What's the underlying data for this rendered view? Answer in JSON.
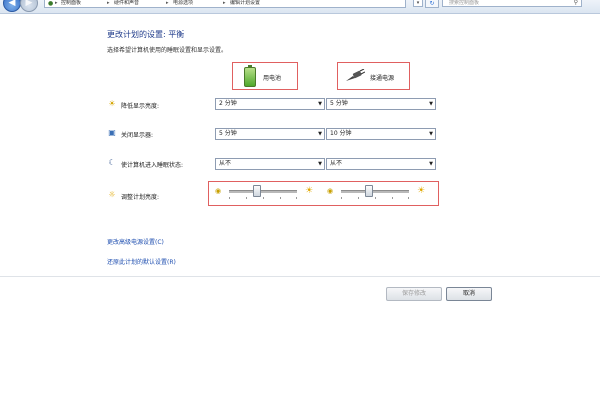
{
  "address_bar": {
    "crumbs": [
      "控制面板",
      "硬件和声音",
      "电源选项",
      "编辑计划设置"
    ],
    "search_placeholder": "搜索控制面板"
  },
  "page": {
    "title": "更改计划的设置: 平衡",
    "subtitle": "选择希望计算机使用的睡眠设置和显示设置。"
  },
  "columns": {
    "on_battery": "用电池",
    "plugged_in": "接通电源"
  },
  "settings": [
    {
      "label": "降低显示亮度:",
      "icon": "dim-display-icon",
      "battery": "2 分钟",
      "plugged": "5 分钟"
    },
    {
      "label": "关闭显示器:",
      "icon": "monitor-icon",
      "battery": "5 分钟",
      "plugged": "10 分钟"
    },
    {
      "label": "使计算机进入睡眠状态:",
      "icon": "sleep-moon-icon",
      "battery": "从不",
      "plugged": "从不"
    }
  ],
  "brightness": {
    "label": "调整计划亮度:",
    "battery_level": 0.4,
    "plugged_level": 0.4
  },
  "links": {
    "advanced": "更改高级电源设置(C)",
    "restore": "还原此计划的默认设置(R)"
  },
  "buttons": {
    "save": "保存修改",
    "cancel": "取消"
  },
  "colors": {
    "highlight_border": "#e06060",
    "link": "#1f4fb0",
    "title": "#1e3a8a"
  }
}
